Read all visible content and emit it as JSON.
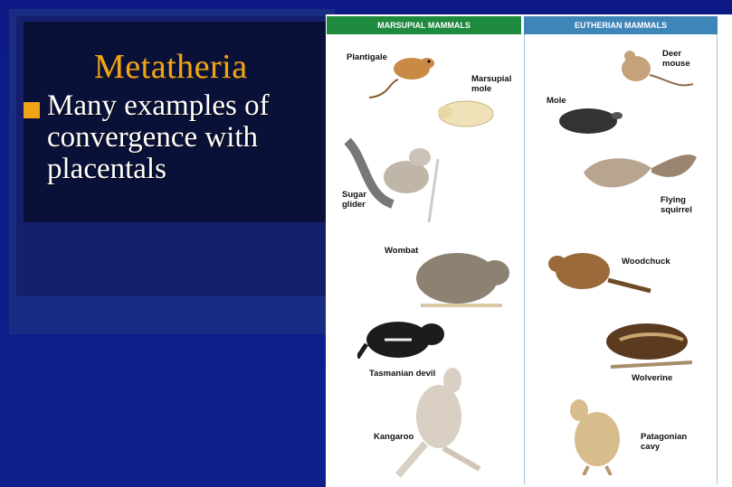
{
  "slide": {
    "title": "Metatheria",
    "bullet": "Many examples of convergence with placentals"
  },
  "figure": {
    "marsupial_header": "Marsupial mammals",
    "eutherian_header": "Eutherian mammals",
    "marsupials": [
      {
        "label": "Plantigale"
      },
      {
        "label": "Marsupial mole"
      },
      {
        "label": "Sugar glider"
      },
      {
        "label": "Wombat"
      },
      {
        "label": "Tasmanian devil"
      },
      {
        "label": "Kangaroo"
      }
    ],
    "eutherians": [
      {
        "label": "Deer mouse"
      },
      {
        "label": "Mole"
      },
      {
        "label": "Flying squirrel"
      },
      {
        "label": "Woodchuck"
      },
      {
        "label": "Wolverine"
      },
      {
        "label": "Patagonian cavy"
      }
    ]
  },
  "colors": {
    "background": "#0f1f8c",
    "title": "#f2a418",
    "marsupial_header": "#1e8a3e",
    "eutherian_header": "#3f86b8"
  }
}
